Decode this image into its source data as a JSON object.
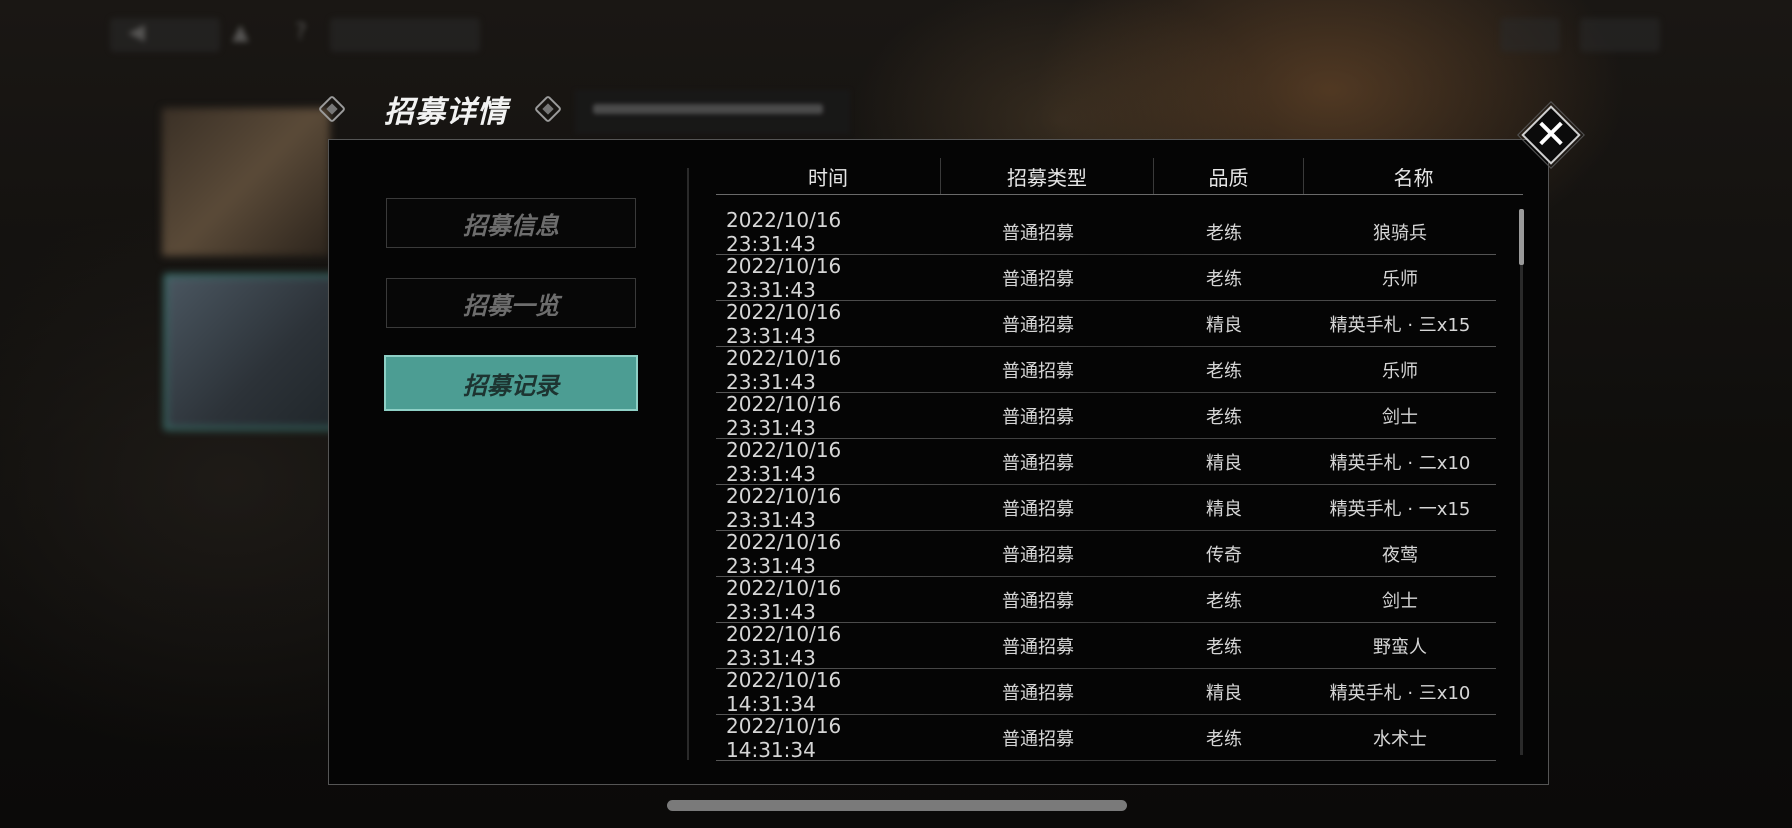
{
  "header": {
    "title": "招募详情"
  },
  "tabs": [
    {
      "label": "招募信息",
      "active": false
    },
    {
      "label": "招募一览",
      "active": false
    },
    {
      "label": "招募记录",
      "active": true
    }
  ],
  "table": {
    "columns": [
      "时间",
      "招募类型",
      "品质",
      "名称"
    ],
    "rows": [
      {
        "time": "2022/10/16  23:31:43",
        "type": "普通招募",
        "quality": "老练",
        "name": "狼骑兵"
      },
      {
        "time": "2022/10/16  23:31:43",
        "type": "普通招募",
        "quality": "老练",
        "name": "乐师"
      },
      {
        "time": "2022/10/16  23:31:43",
        "type": "普通招募",
        "quality": "精良",
        "name": "精英手札 · 三x15"
      },
      {
        "time": "2022/10/16  23:31:43",
        "type": "普通招募",
        "quality": "老练",
        "name": "乐师"
      },
      {
        "time": "2022/10/16  23:31:43",
        "type": "普通招募",
        "quality": "老练",
        "name": "剑士"
      },
      {
        "time": "2022/10/16  23:31:43",
        "type": "普通招募",
        "quality": "精良",
        "name": "精英手札 · 二x10"
      },
      {
        "time": "2022/10/16  23:31:43",
        "type": "普通招募",
        "quality": "精良",
        "name": "精英手札 · 一x15"
      },
      {
        "time": "2022/10/16  23:31:43",
        "type": "普通招募",
        "quality": "传奇",
        "name": "夜莺"
      },
      {
        "time": "2022/10/16  23:31:43",
        "type": "普通招募",
        "quality": "老练",
        "name": "剑士"
      },
      {
        "time": "2022/10/16  23:31:43",
        "type": "普通招募",
        "quality": "老练",
        "name": "野蛮人"
      },
      {
        "time": "2022/10/16  14:31:34",
        "type": "普通招募",
        "quality": "精良",
        "name": "精英手札 · 三x10"
      },
      {
        "time": "2022/10/16  14:31:34",
        "type": "普通招募",
        "quality": "老练",
        "name": "水术士"
      }
    ]
  },
  "icons": {
    "prev": "prev-arrow-icon",
    "next": "next-arrow-icon",
    "close": "close-icon",
    "close_glyph": "✕"
  },
  "colors": {
    "accent": "#4c9d93",
    "panel_bg": "#050505"
  }
}
